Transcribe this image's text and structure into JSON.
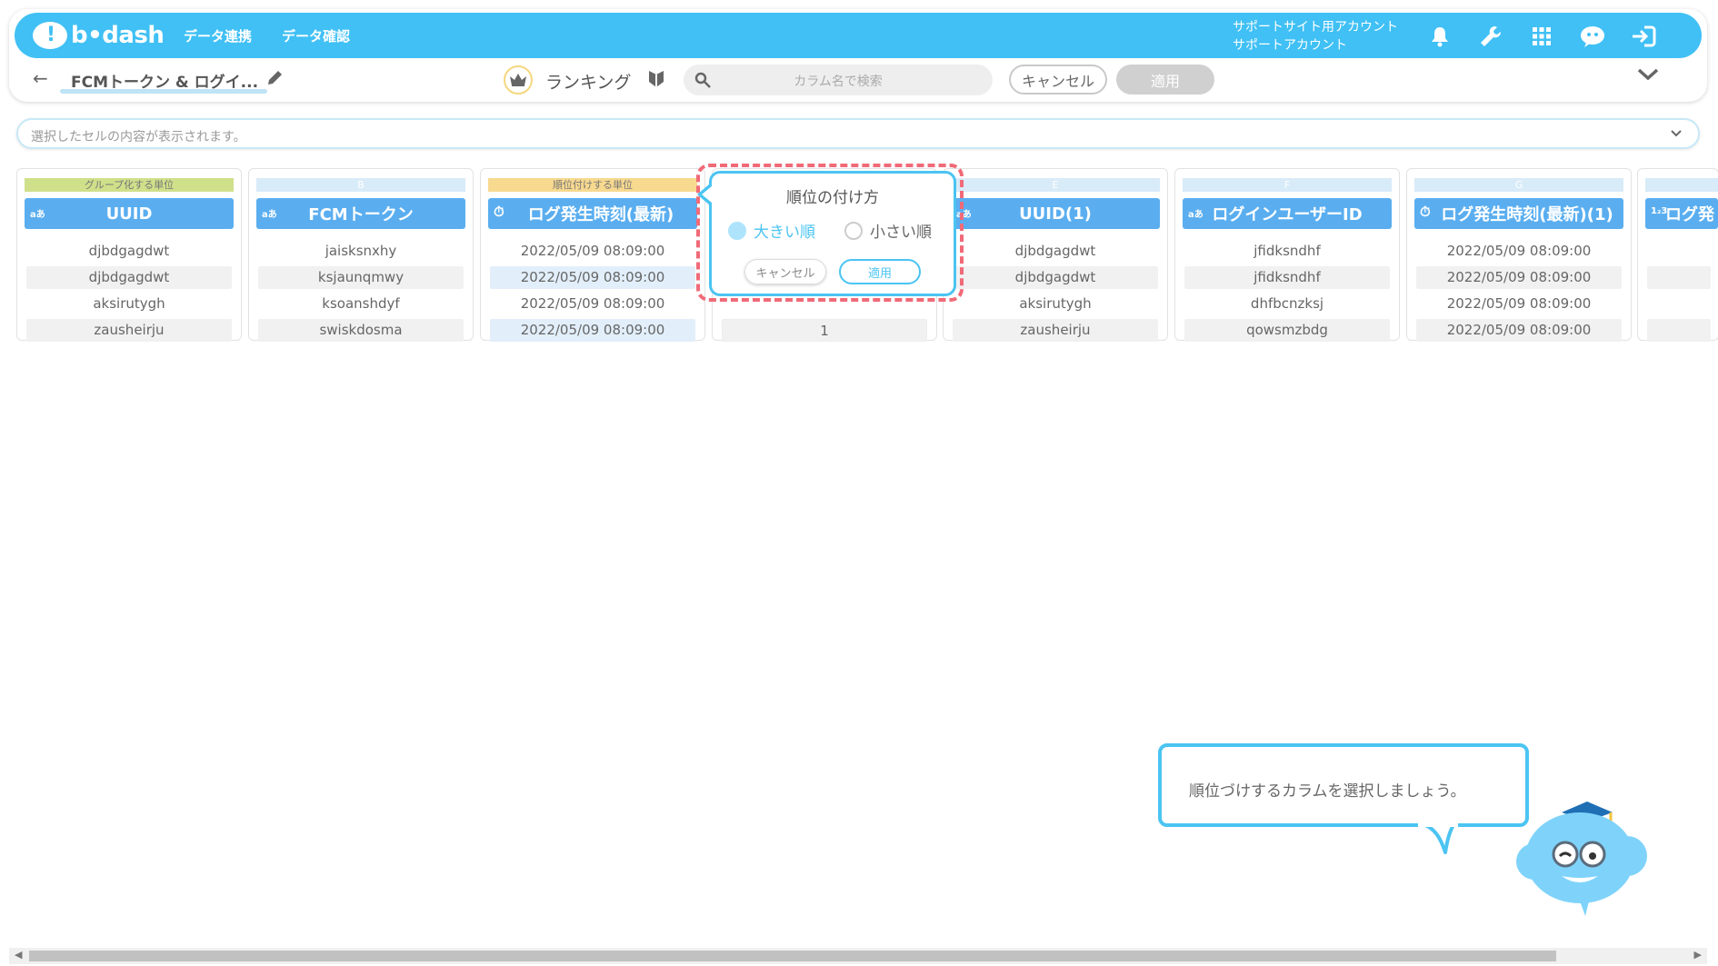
{
  "app": {
    "logo_text": "b•dash",
    "nav": [
      "データ連携",
      "データ確認"
    ],
    "account_line1": "サポートサイト用アカウント",
    "account_line2": "サポートアカウント",
    "accent": "#40c0f5"
  },
  "toolbar": {
    "back_icon": "←",
    "title": "FCMトークン & ログイ...",
    "mode_label": "ランキング",
    "search_placeholder": "カラム名で検索",
    "cancel_label": "キャンセル",
    "apply_label": "適用"
  },
  "preview": {
    "placeholder": "選択したセルの内容が表示されます。"
  },
  "columns": [
    {
      "strip": "グループ化する単位",
      "type": "aあ",
      "header": "UUID",
      "cells": [
        "djbdgagdwt",
        "djbdgagdwt",
        "aksirutygh",
        "zausheirju"
      ]
    },
    {
      "strip": "B",
      "type": "aあ",
      "header": "FCMトークン",
      "cells": [
        "jaisksnxhy",
        "ksjaunqmwy",
        "ksoanshdyf",
        "swiskdosma"
      ]
    },
    {
      "strip": "順位付けする単位",
      "type": "⏱",
      "header": "ログ発生時刻(最新)",
      "cells": [
        "2022/05/09 08:09:00",
        "2022/05/09 08:09:00",
        "2022/05/09 08:09:00",
        "2022/05/09 08:09:00"
      ]
    },
    {
      "strip": "",
      "type": "",
      "header": "",
      "cells": [
        "",
        "",
        "",
        "1"
      ]
    },
    {
      "strip": "E",
      "type": "aあ",
      "header": "UUID(1)",
      "cells": [
        "djbdgagdwt",
        "djbdgagdwt",
        "aksirutygh",
        "zausheirju"
      ]
    },
    {
      "strip": "F",
      "type": "aあ",
      "header": "ログインユーザーID",
      "cells": [
        "jfidksndhf",
        "jfidksndhf",
        "dhfbcnzksj",
        "qowsmzbdg"
      ]
    },
    {
      "strip": "G",
      "type": "⏱",
      "header": "ログ発生時刻(最新)(1)",
      "cells": [
        "2022/05/09 08:09:00",
        "2022/05/09 08:09:00",
        "2022/05/09 08:09:00",
        "2022/05/09 08:09:00"
      ]
    },
    {
      "strip": "",
      "type": "1₂3",
      "header": "ログ発",
      "cells": [
        "",
        "",
        "",
        ""
      ]
    }
  ],
  "popup": {
    "title": "順位の付け方",
    "option_desc": "大きい順",
    "option_asc": "小さい順",
    "cancel_label": "キャンセル",
    "apply_label": "適用"
  },
  "guide": {
    "text": "順位づけするカラムを選択しましょう。"
  }
}
